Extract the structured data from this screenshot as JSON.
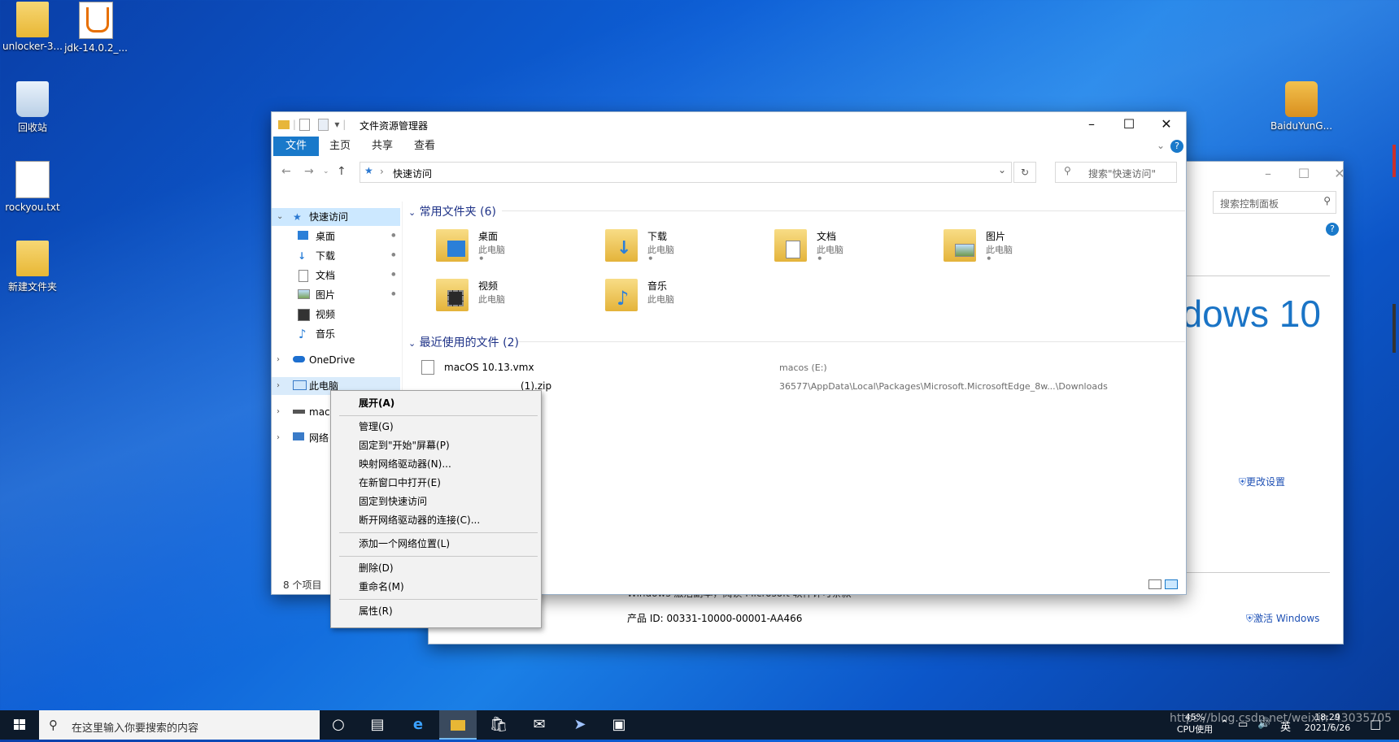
{
  "desktop": {
    "icons": [
      {
        "label": "unlocker-3..."
      },
      {
        "label": "jdk-14.0.2_..."
      },
      {
        "label": "回收站"
      },
      {
        "label": "rockyou.txt"
      },
      {
        "label": "新建文件夹"
      },
      {
        "label": "BaiduYunG..."
      }
    ]
  },
  "explorer": {
    "title": "文件资源管理器",
    "ribbon_tabs": [
      "文件",
      "主页",
      "共享",
      "查看"
    ],
    "address": "快速访问",
    "search_placeholder": "搜索\"快速访问\"",
    "nav": {
      "quick_access": "快速访问",
      "items": [
        "桌面",
        "下载",
        "文档",
        "图片",
        "视频",
        "音乐"
      ],
      "onedrive": "OneDrive",
      "this_pc": "此电脑",
      "macos": "macos (E:)",
      "network": "网络"
    },
    "frequent_header": "常用文件夹 (6)",
    "folders": [
      {
        "name": "桌面",
        "location": "此电脑"
      },
      {
        "name": "下载",
        "location": "此电脑"
      },
      {
        "name": "文档",
        "location": "此电脑"
      },
      {
        "name": "图片",
        "location": "此电脑"
      },
      {
        "name": "视频",
        "location": "此电脑"
      },
      {
        "name": "音乐",
        "location": "此电脑"
      }
    ],
    "recent_header": "最近使用的文件 (2)",
    "recent": [
      {
        "name": "macOS 10.13.vmx",
        "path": "macos (E:)"
      },
      {
        "name": "(1).zip",
        "path": "36577\\AppData\\Local\\Packages\\Microsoft.MicrosoftEdge_8w...\\Downloads"
      }
    ],
    "status": "8 个项目"
  },
  "control_panel": {
    "search_placeholder": "搜索控制面板",
    "brand": "ndows 10",
    "change_settings": "更改设置",
    "license_text": "Windows 激活副本，阅读 Microsoft 软件许可条款",
    "product_id": "产品 ID: 00331-10000-00001-AA466",
    "activate": "激活 Windows"
  },
  "context_menu": {
    "items": [
      {
        "label": "展开(A)",
        "bold": true
      },
      {
        "label": "管理(G)"
      },
      {
        "label": "固定到\"开始\"屏幕(P)"
      },
      {
        "label": "映射网络驱动器(N)..."
      },
      {
        "label": "在新窗口中打开(E)"
      },
      {
        "label": "固定到快速访问"
      },
      {
        "label": "断开网络驱动器的连接(C)..."
      },
      {
        "label": "添加一个网络位置(L)"
      },
      {
        "label": "删除(D)"
      },
      {
        "label": "重命名(M)"
      },
      {
        "label": "属性(R)"
      }
    ]
  },
  "taskbar": {
    "search_placeholder": "在这里输入你要搜索的内容",
    "cpu_percent": "45%",
    "cpu_label": "CPU使用",
    "time": "18:29",
    "date": "2021/6/26",
    "ime": "英",
    "watermark": "https://blog.csdn.net/weixin_43035705"
  },
  "colors": {
    "accent": "#1979ca",
    "selection": "#cce8ff",
    "section_title": "#1e3287"
  }
}
